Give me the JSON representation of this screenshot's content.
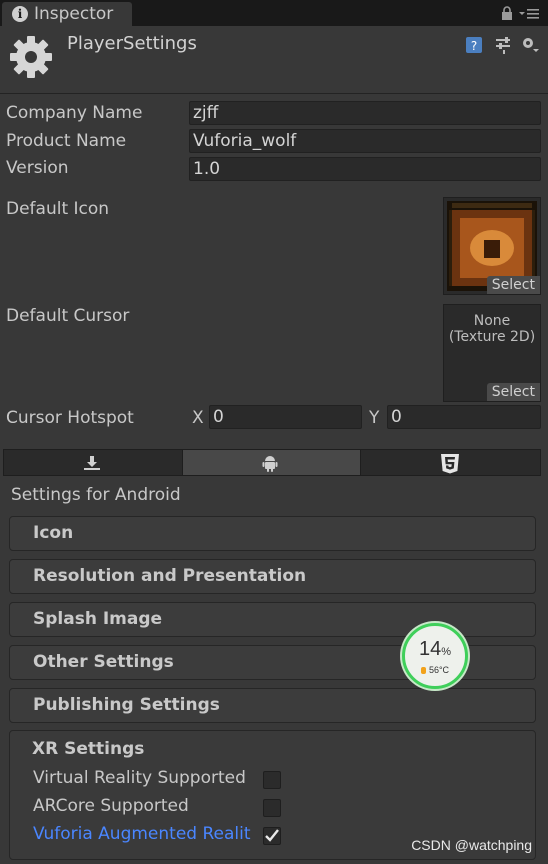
{
  "window": {
    "tab_label": "Inspector"
  },
  "header": {
    "title": "PlayerSettings"
  },
  "fields": [
    {
      "label": "Company Name",
      "value": "zjff"
    },
    {
      "label": "Product Name",
      "value": "Vuforia_wolf"
    },
    {
      "label": "Version",
      "value": "1.0"
    }
  ],
  "default_icon": {
    "label": "Default Icon",
    "select_label": "Select"
  },
  "default_cursor": {
    "label": "Default Cursor",
    "value_line1": "None",
    "value_line2": "(Texture 2D)",
    "select_label": "Select"
  },
  "cursor_hotspot": {
    "label": "Cursor Hotspot",
    "x_label": "X",
    "x_value": "0",
    "y_label": "Y",
    "y_value": "0"
  },
  "platform_tabs": [
    {
      "icon": "download-icon",
      "active": false
    },
    {
      "icon": "android-icon",
      "active": true
    },
    {
      "icon": "html5-icon",
      "active": false
    }
  ],
  "settings_for": "Settings for Android",
  "sections": [
    {
      "title": "Icon"
    },
    {
      "title": "Resolution and Presentation"
    },
    {
      "title": "Splash Image"
    },
    {
      "title": "Other Settings"
    },
    {
      "title": "Publishing Settings"
    }
  ],
  "xr_settings": {
    "title": "XR Settings",
    "options": [
      {
        "label": "Virtual Reality Supported",
        "checked": false,
        "highlight": false
      },
      {
        "label": "ARCore Supported",
        "checked": false,
        "highlight": false
      },
      {
        "label": "Vuforia Augmented Realit",
        "checked": true,
        "highlight": true
      }
    ]
  },
  "overlay": {
    "percent": "14",
    "percent_unit": "%",
    "temperature": "56°C"
  },
  "watermark": "CSDN @watchping",
  "colors": {
    "highlight_text": "#4a86ff",
    "overlay_ring": "#3fcf5a"
  }
}
